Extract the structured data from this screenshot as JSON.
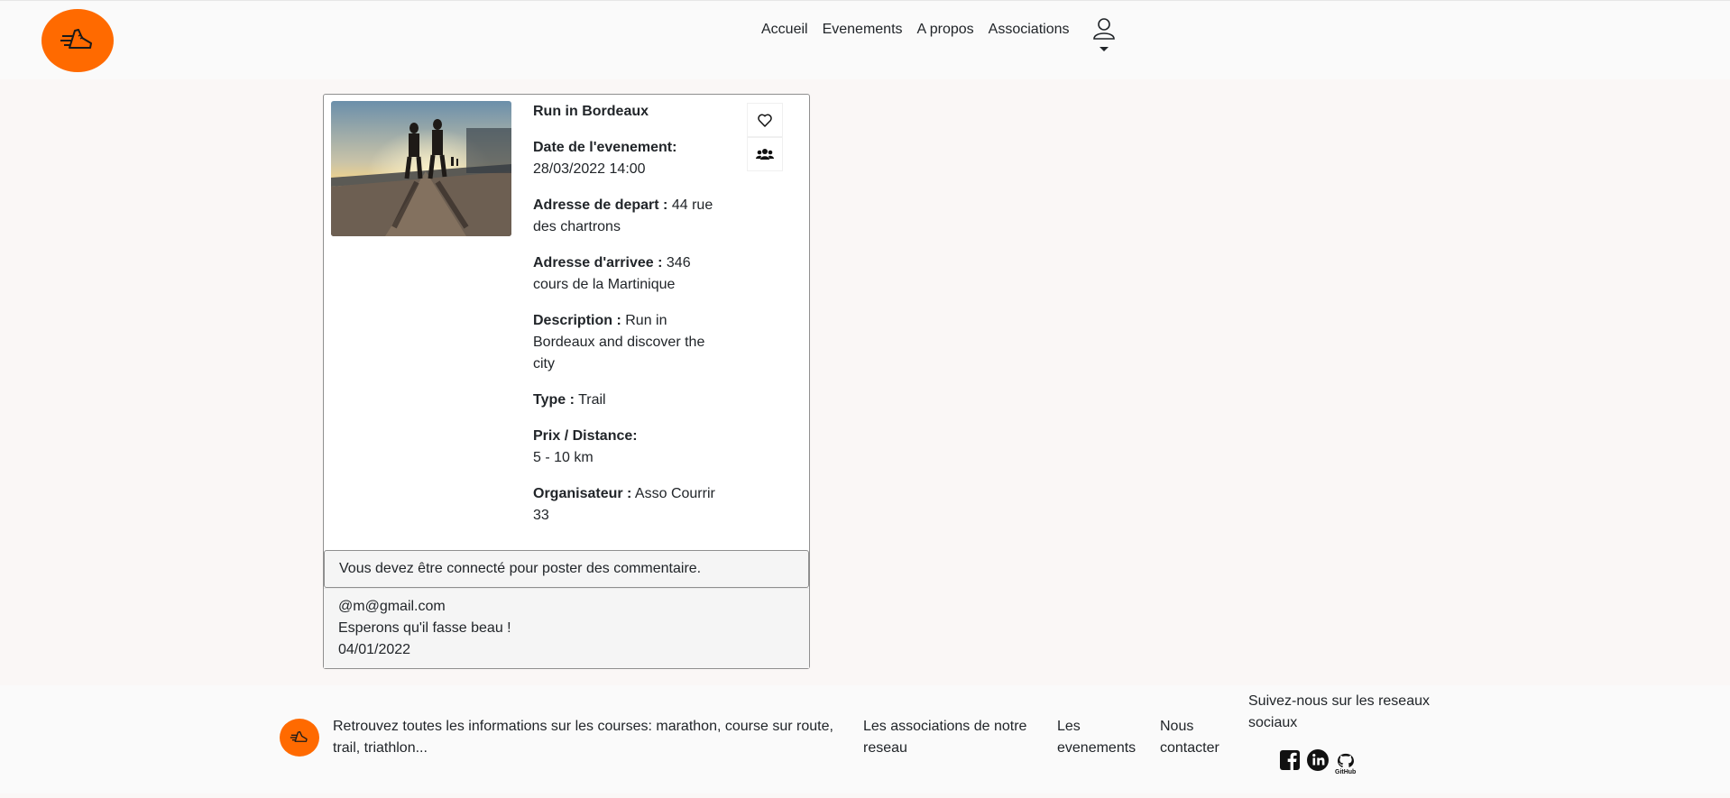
{
  "header": {
    "nav": [
      "Accueil",
      "Evenements",
      "A propos",
      "Associations"
    ],
    "brand_color": "#ff6a00",
    "user_icon": "user-icon"
  },
  "event": {
    "title": "Run in Bordeaux",
    "date_label": "Date de l'evenement:",
    "date_value": "28/03/2022 14:00",
    "start_label": "Adresse de depart :",
    "start_value": "44 rue des chartrons",
    "end_label": "Adresse d'arrivee :",
    "end_value": "346 cours de la Martinique",
    "desc_label": "Description :",
    "desc_value": "Run in Bordeaux and discover the city",
    "type_label": "Type :",
    "type_value": "Trail",
    "price_label": "Prix / Distance:",
    "price_value": "5 - 10 km",
    "org_label": "Organisateur :",
    "org_value": "Asso Courrir 33"
  },
  "comments": {
    "notice": "Vous devez être connecté pour poster des commentaire.",
    "items": [
      {
        "author": "@m@gmail.com",
        "text": "Esperons qu'il fasse beau !",
        "date": "04/01/2022"
      }
    ]
  },
  "footer": {
    "about": "Retrouvez toutes les informations sur les courses: marathon, course sur route, trail, triathlon...",
    "associations": "Les associations de notre reseau",
    "events": "Les evenements",
    "contact": "Nous contacter",
    "follow": "Suivez-nous sur les reseaux sociaux",
    "github_label": "GitHub"
  }
}
